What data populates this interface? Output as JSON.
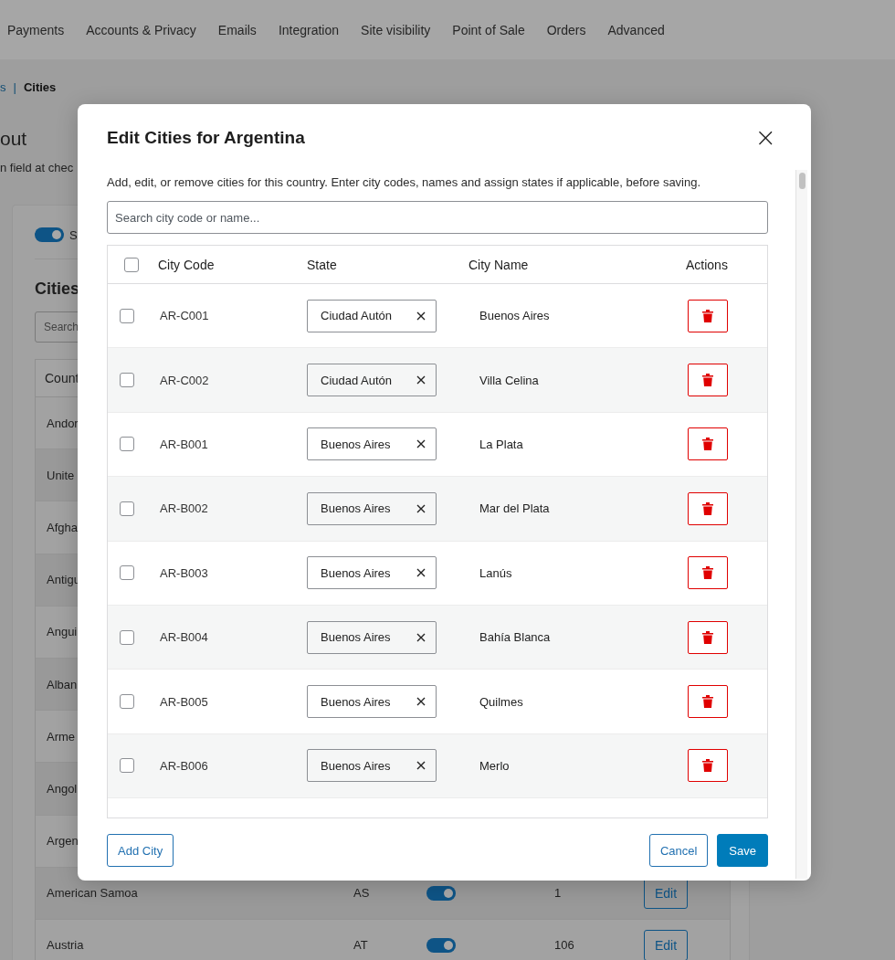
{
  "nav_tabs": [
    {
      "label": "Payments"
    },
    {
      "label": "Accounts & Privacy"
    },
    {
      "label": "Emails"
    },
    {
      "label": "Integration"
    },
    {
      "label": "Site visibility"
    },
    {
      "label": "Point of Sale"
    },
    {
      "label": "Orders"
    },
    {
      "label": "Advanced"
    }
  ],
  "breadcrumb": {
    "link": "s",
    "separator": "|",
    "current": "Cities"
  },
  "page_heading": "out",
  "page_description": "n field at chec",
  "card": {
    "toggle": {
      "on": true,
      "label": "S"
    },
    "section_title": "Cities",
    "search": {
      "placeholder": "Search"
    },
    "table": {
      "column_1": "Count",
      "rows": [
        {
          "country": "Andor"
        },
        {
          "country": "Unite"
        },
        {
          "country": "Afgha"
        },
        {
          "country": "Antigu"
        },
        {
          "country": "Angui"
        },
        {
          "country": "Alban"
        },
        {
          "country": "Arme"
        },
        {
          "country": "Angol"
        },
        {
          "country": "Argen"
        },
        {
          "country": "American Samoa",
          "code": "AS",
          "on": true,
          "count": "1",
          "action": "Edit"
        },
        {
          "country": "Austria",
          "code": "AT",
          "on": true,
          "count": "106",
          "action": "Edit"
        }
      ]
    }
  },
  "modal": {
    "title": "Edit Cities for Argentina",
    "close": "×",
    "description": "Add, edit, or remove cities for this country. Enter city codes, names and assign states if applicable, before saving.",
    "search": {
      "placeholder": "Search city code or name..."
    },
    "columns": [
      "City Code",
      "State",
      "City Name",
      "Actions"
    ],
    "select_all": {
      "checked": false
    },
    "rows": [
      {
        "checked": false,
        "code": "AR-C001",
        "state": "Ciudad Autón",
        "name": "Buenos Aires"
      },
      {
        "checked": false,
        "code": "AR-C002",
        "state": "Ciudad Autón",
        "name": "Villa Celina"
      },
      {
        "checked": false,
        "code": "AR-B001",
        "state": "Buenos Aires",
        "name": "La Plata"
      },
      {
        "checked": false,
        "code": "AR-B002",
        "state": "Buenos Aires",
        "name": "Mar del Plata"
      },
      {
        "checked": false,
        "code": "AR-B003",
        "state": "Buenos Aires",
        "name": "Lanús"
      },
      {
        "checked": false,
        "code": "AR-B004",
        "state": "Buenos Aires",
        "name": "Bahía Blanca"
      },
      {
        "checked": false,
        "code": "AR-B005",
        "state": "Buenos Aires",
        "name": "Quilmes"
      },
      {
        "checked": false,
        "code": "AR-B006",
        "state": "Buenos Aires",
        "name": "Merlo"
      }
    ],
    "buttons": {
      "add": "Add City",
      "cancel": "Cancel",
      "save": "Save"
    }
  }
}
